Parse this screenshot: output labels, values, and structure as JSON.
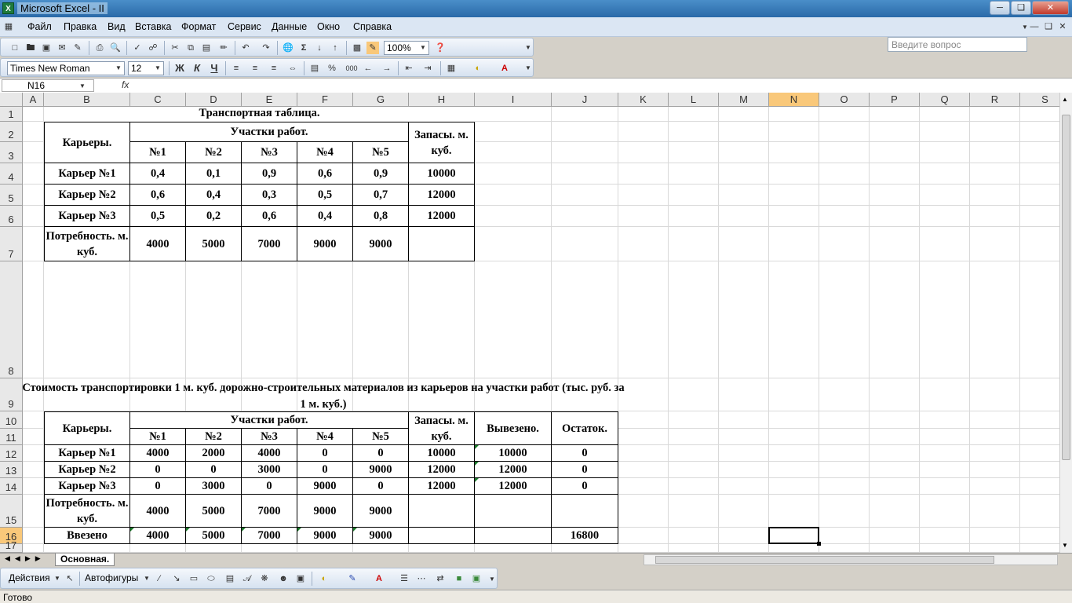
{
  "window": {
    "title": "Microsoft Excel - II"
  },
  "menu": [
    "Файл",
    "Правка",
    "Вид",
    "Вставка",
    "Формат",
    "Сервис",
    "Данные",
    "Окно",
    "Справка"
  ],
  "help_placeholder": "Введите вопрос",
  "toolbar": {
    "zoom": "100%",
    "font": "Times New Roman",
    "size": "12",
    "bold": "Ж",
    "italic": "К",
    "underline": "Ч",
    "percent": "%",
    "thousands": "000",
    "sum": "Σ",
    "fx": "fx"
  },
  "namebox": "N16",
  "columns": [
    "A",
    "B",
    "C",
    "D",
    "E",
    "F",
    "G",
    "H",
    "I",
    "J",
    "K",
    "L",
    "M",
    "N",
    "O",
    "P",
    "Q",
    "R",
    "S"
  ],
  "rows": [
    "1",
    "2",
    "3",
    "4",
    "5",
    "6",
    "7",
    "8",
    "9",
    "10",
    "11",
    "12",
    "13",
    "14",
    "15",
    "16",
    "17"
  ],
  "table1": {
    "title": "Транспортная таблица.",
    "quarries_header": "Карьеры.",
    "sites_header": "Участки работ.",
    "stock_header": "Запасы. м. куб.",
    "sites": [
      "№1",
      "№2",
      "№3",
      "№4",
      "№5"
    ],
    "rows": [
      {
        "name": "Карьер №1",
        "values": [
          "0,4",
          "0,1",
          "0,9",
          "0,6",
          "0,9"
        ],
        "stock": "10000"
      },
      {
        "name": "Карьер №2",
        "values": [
          "0,6",
          "0,4",
          "0,3",
          "0,5",
          "0,7"
        ],
        "stock": "12000"
      },
      {
        "name": "Карьер №3",
        "values": [
          "0,5",
          "0,2",
          "0,6",
          "0,4",
          "0,8"
        ],
        "stock": "12000"
      }
    ],
    "need_label": "Потребность. м. куб.",
    "need": [
      "4000",
      "5000",
      "7000",
      "9000",
      "9000"
    ]
  },
  "table2": {
    "title": "Стоимость транспортировки 1 м. куб. дорожно-строительных материалов из карьеров на участки работ (тыс. руб. за 1 м. куб.)",
    "quarries_header": "Карьеры.",
    "sites_header": "Участки работ.",
    "stock_header": "Запасы. м. куб.",
    "exported_header": "Вывезено.",
    "rest_header": "Остаток.",
    "sites": [
      "№1",
      "№2",
      "№3",
      "№4",
      "№5"
    ],
    "rows": [
      {
        "name": "Карьер №1",
        "values": [
          "4000",
          "2000",
          "4000",
          "0",
          "0"
        ],
        "stock": "10000",
        "exported": "10000",
        "rest": "0"
      },
      {
        "name": "Карьер №2",
        "values": [
          "0",
          "0",
          "3000",
          "0",
          "9000"
        ],
        "stock": "12000",
        "exported": "12000",
        "rest": "0"
      },
      {
        "name": "Карьер №3",
        "values": [
          "0",
          "3000",
          "0",
          "9000",
          "0"
        ],
        "stock": "12000",
        "exported": "12000",
        "rest": "0"
      }
    ],
    "need_label": "Потребность. м. куб.",
    "need": [
      "4000",
      "5000",
      "7000",
      "9000",
      "9000"
    ],
    "imported_label": "Ввезено",
    "imported": [
      "4000",
      "5000",
      "7000",
      "9000",
      "9000"
    ],
    "total": "16800"
  },
  "sheet_tab": "Основная.",
  "drawbar": {
    "actions": "Действия",
    "autoshapes": "Автофигуры"
  },
  "status": "Готово",
  "colors": {
    "selected_header": "#f9c87a",
    "title_bar": "#2a6aa8"
  }
}
